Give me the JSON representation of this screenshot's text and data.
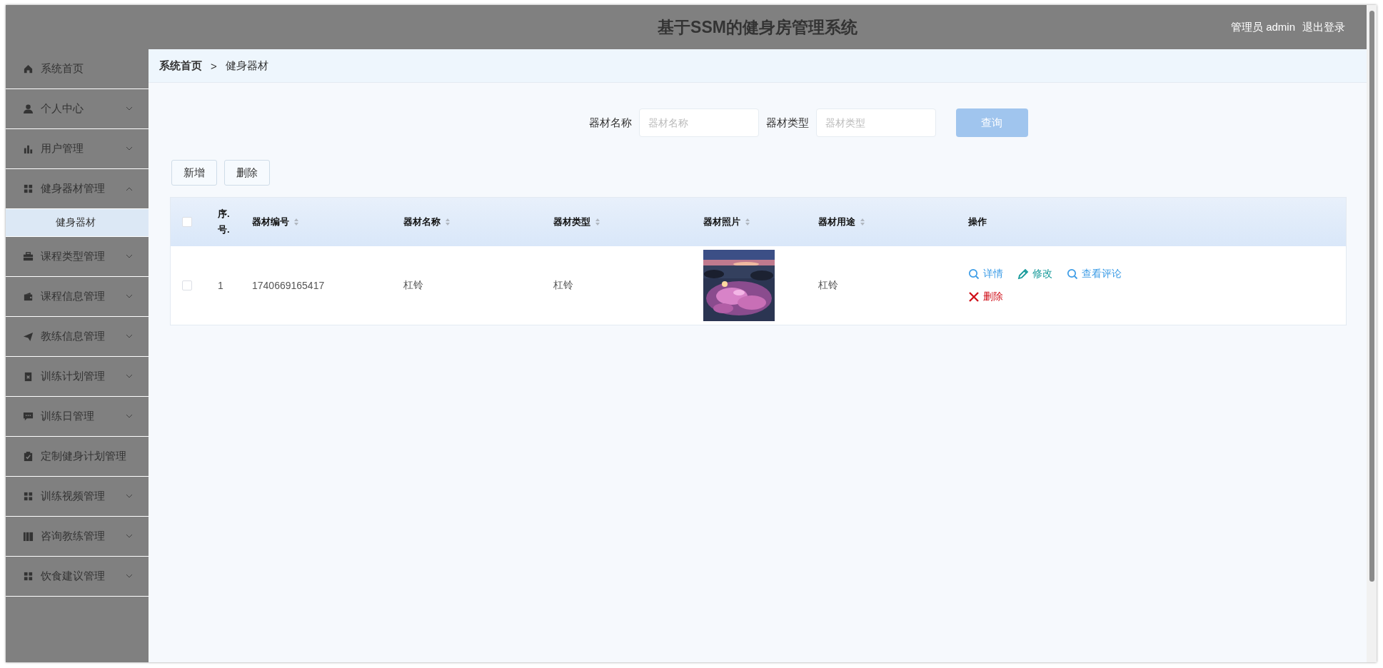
{
  "header": {
    "title": "基于SSM的健身房管理系统",
    "user_label": "管理员 admin",
    "logout": "退出登录"
  },
  "sidebar": {
    "items": [
      {
        "label": "系统首页"
      },
      {
        "label": "个人中心",
        "expanded": false
      },
      {
        "label": "用户管理",
        "expanded": false
      },
      {
        "label": "健身器材管理",
        "expanded": true,
        "children": [
          {
            "label": "健身器材",
            "selected": true
          }
        ]
      },
      {
        "label": "课程类型管理",
        "expanded": false
      },
      {
        "label": "课程信息管理",
        "expanded": false
      },
      {
        "label": "教练信息管理",
        "expanded": false
      },
      {
        "label": "训练计划管理",
        "expanded": false
      },
      {
        "label": "训练日管理",
        "expanded": false
      },
      {
        "label": "定制健身计划管理"
      },
      {
        "label": "训练视频管理",
        "expanded": false
      },
      {
        "label": "咨询教练管理",
        "expanded": false
      },
      {
        "label": "饮食建议管理",
        "expanded": false
      }
    ]
  },
  "breadcrumb": {
    "items": [
      "系统首页",
      "健身器材"
    ],
    "separator": ">"
  },
  "search": {
    "fields": [
      {
        "label": "器材名称",
        "placeholder": "器材名称"
      },
      {
        "label": "器材类型",
        "placeholder": "器材类型"
      }
    ],
    "button": "查询"
  },
  "toolbar": [
    "新增",
    "删除"
  ],
  "table": {
    "all_selected": false,
    "columns": [
      {
        "label": "序. 号.",
        "sortable": false
      },
      {
        "label": "器材编号",
        "sortable": true
      },
      {
        "label": "器材名称",
        "sortable": true
      },
      {
        "label": "器材类型",
        "sortable": true
      },
      {
        "label": "器材照片",
        "sortable": true
      },
      {
        "label": "器材用途",
        "sortable": true
      },
      {
        "label": "操作",
        "sortable": false
      }
    ],
    "rows": [
      {
        "selected": false,
        "index": "1",
        "code": "1740669165417",
        "name": "杠铃",
        "type": "杠铃",
        "use": "杠铃",
        "actions": [
          {
            "label": "详情",
            "kind": "view"
          },
          {
            "label": "修改",
            "kind": "edit"
          },
          {
            "label": "查看评论",
            "kind": "view"
          },
          {
            "label": "删除",
            "kind": "delete"
          }
        ]
      }
    ]
  }
}
